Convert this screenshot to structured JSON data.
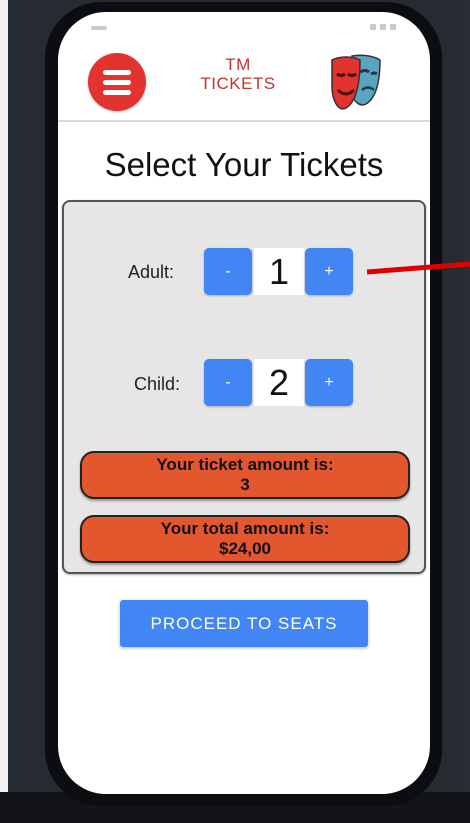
{
  "header": {
    "brand_line1": "TM",
    "brand_line2": "TICKETS",
    "menu_icon": "hamburger-menu-icon",
    "logo_icon": "theater-masks-icon"
  },
  "page": {
    "title": "Select Your Tickets"
  },
  "tickets": {
    "adult": {
      "label": "Adult:",
      "minus": "-",
      "plus": "+",
      "count": "1"
    },
    "child": {
      "label": "Child:",
      "minus": "-",
      "plus": "+",
      "count": "2"
    }
  },
  "summary": {
    "ticket_amount_label": "Your ticket amount is:",
    "ticket_amount_value": "3",
    "total_amount_label": "Your total amount is:",
    "total_amount_value": "$24,00"
  },
  "actions": {
    "proceed_label": "PROCEED TO SEATS"
  },
  "colors": {
    "accent_red": "#e2332f",
    "button_blue": "#4285f4",
    "amount_orange": "#e3572f",
    "annotation_arrow": "#e00000"
  }
}
